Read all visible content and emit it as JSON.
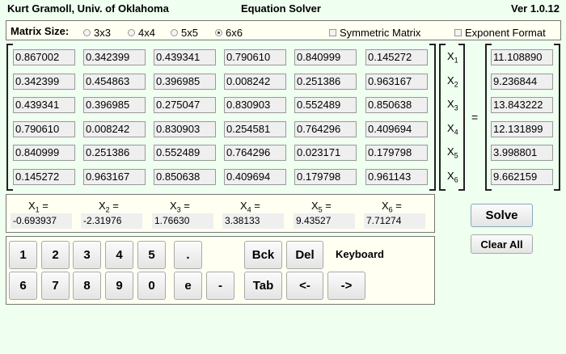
{
  "header": {
    "author": "Kurt Gramoll, Univ. of Oklahoma",
    "title": "Equation Solver",
    "version": "Ver 1.0.12"
  },
  "options": {
    "matrix_size_label": "Matrix Size:",
    "sizes": [
      {
        "label": "3x3",
        "selected": false
      },
      {
        "label": "4x4",
        "selected": false
      },
      {
        "label": "5x5",
        "selected": false
      },
      {
        "label": "6x6",
        "selected": true
      }
    ],
    "symmetric": {
      "label": "Symmetric Matrix",
      "checked": false
    },
    "exponent": {
      "label": "Exponent Format",
      "checked": false
    }
  },
  "matrix": [
    [
      "0.867002",
      "0.342399",
      "0.439341",
      "0.790610",
      "0.840999",
      "0.145272"
    ],
    [
      "0.342399",
      "0.454863",
      "0.396985",
      "0.008242",
      "0.251386",
      "0.963167"
    ],
    [
      "0.439341",
      "0.396985",
      "0.275047",
      "0.830903",
      "0.552489",
      "0.850638"
    ],
    [
      "0.790610",
      "0.008242",
      "0.830903",
      "0.254581",
      "0.764296",
      "0.409694"
    ],
    [
      "0.840999",
      "0.251386",
      "0.552489",
      "0.764296",
      "0.023171",
      "0.179798"
    ],
    [
      "0.145272",
      "0.963167",
      "0.850638",
      "0.409694",
      "0.179798",
      "0.961143"
    ]
  ],
  "variables": [
    {
      "base": "X",
      "sub": "1"
    },
    {
      "base": "X",
      "sub": "2"
    },
    {
      "base": "X",
      "sub": "3"
    },
    {
      "base": "X",
      "sub": "4"
    },
    {
      "base": "X",
      "sub": "5"
    },
    {
      "base": "X",
      "sub": "6"
    }
  ],
  "equals": "=",
  "rhs": [
    "11.108890",
    "9.236844",
    "13.843222",
    "12.131899",
    "3.998801",
    "9.662159"
  ],
  "results": [
    "-0.693937",
    "-2.31976",
    "1.76630",
    "3.38133",
    "9.43527",
    "7.71274"
  ],
  "buttons": {
    "solve": "Solve",
    "clear_all": "Clear All"
  },
  "keyboard": {
    "label": "Keyboard",
    "row1": [
      "1",
      "2",
      "3",
      "4",
      "5",
      "."
    ],
    "row2": [
      "6",
      "7",
      "8",
      "9",
      "0",
      "e",
      "-"
    ],
    "bck": "Bck",
    "del": "Del",
    "tab": "Tab",
    "left": "<-",
    "right": "->"
  }
}
